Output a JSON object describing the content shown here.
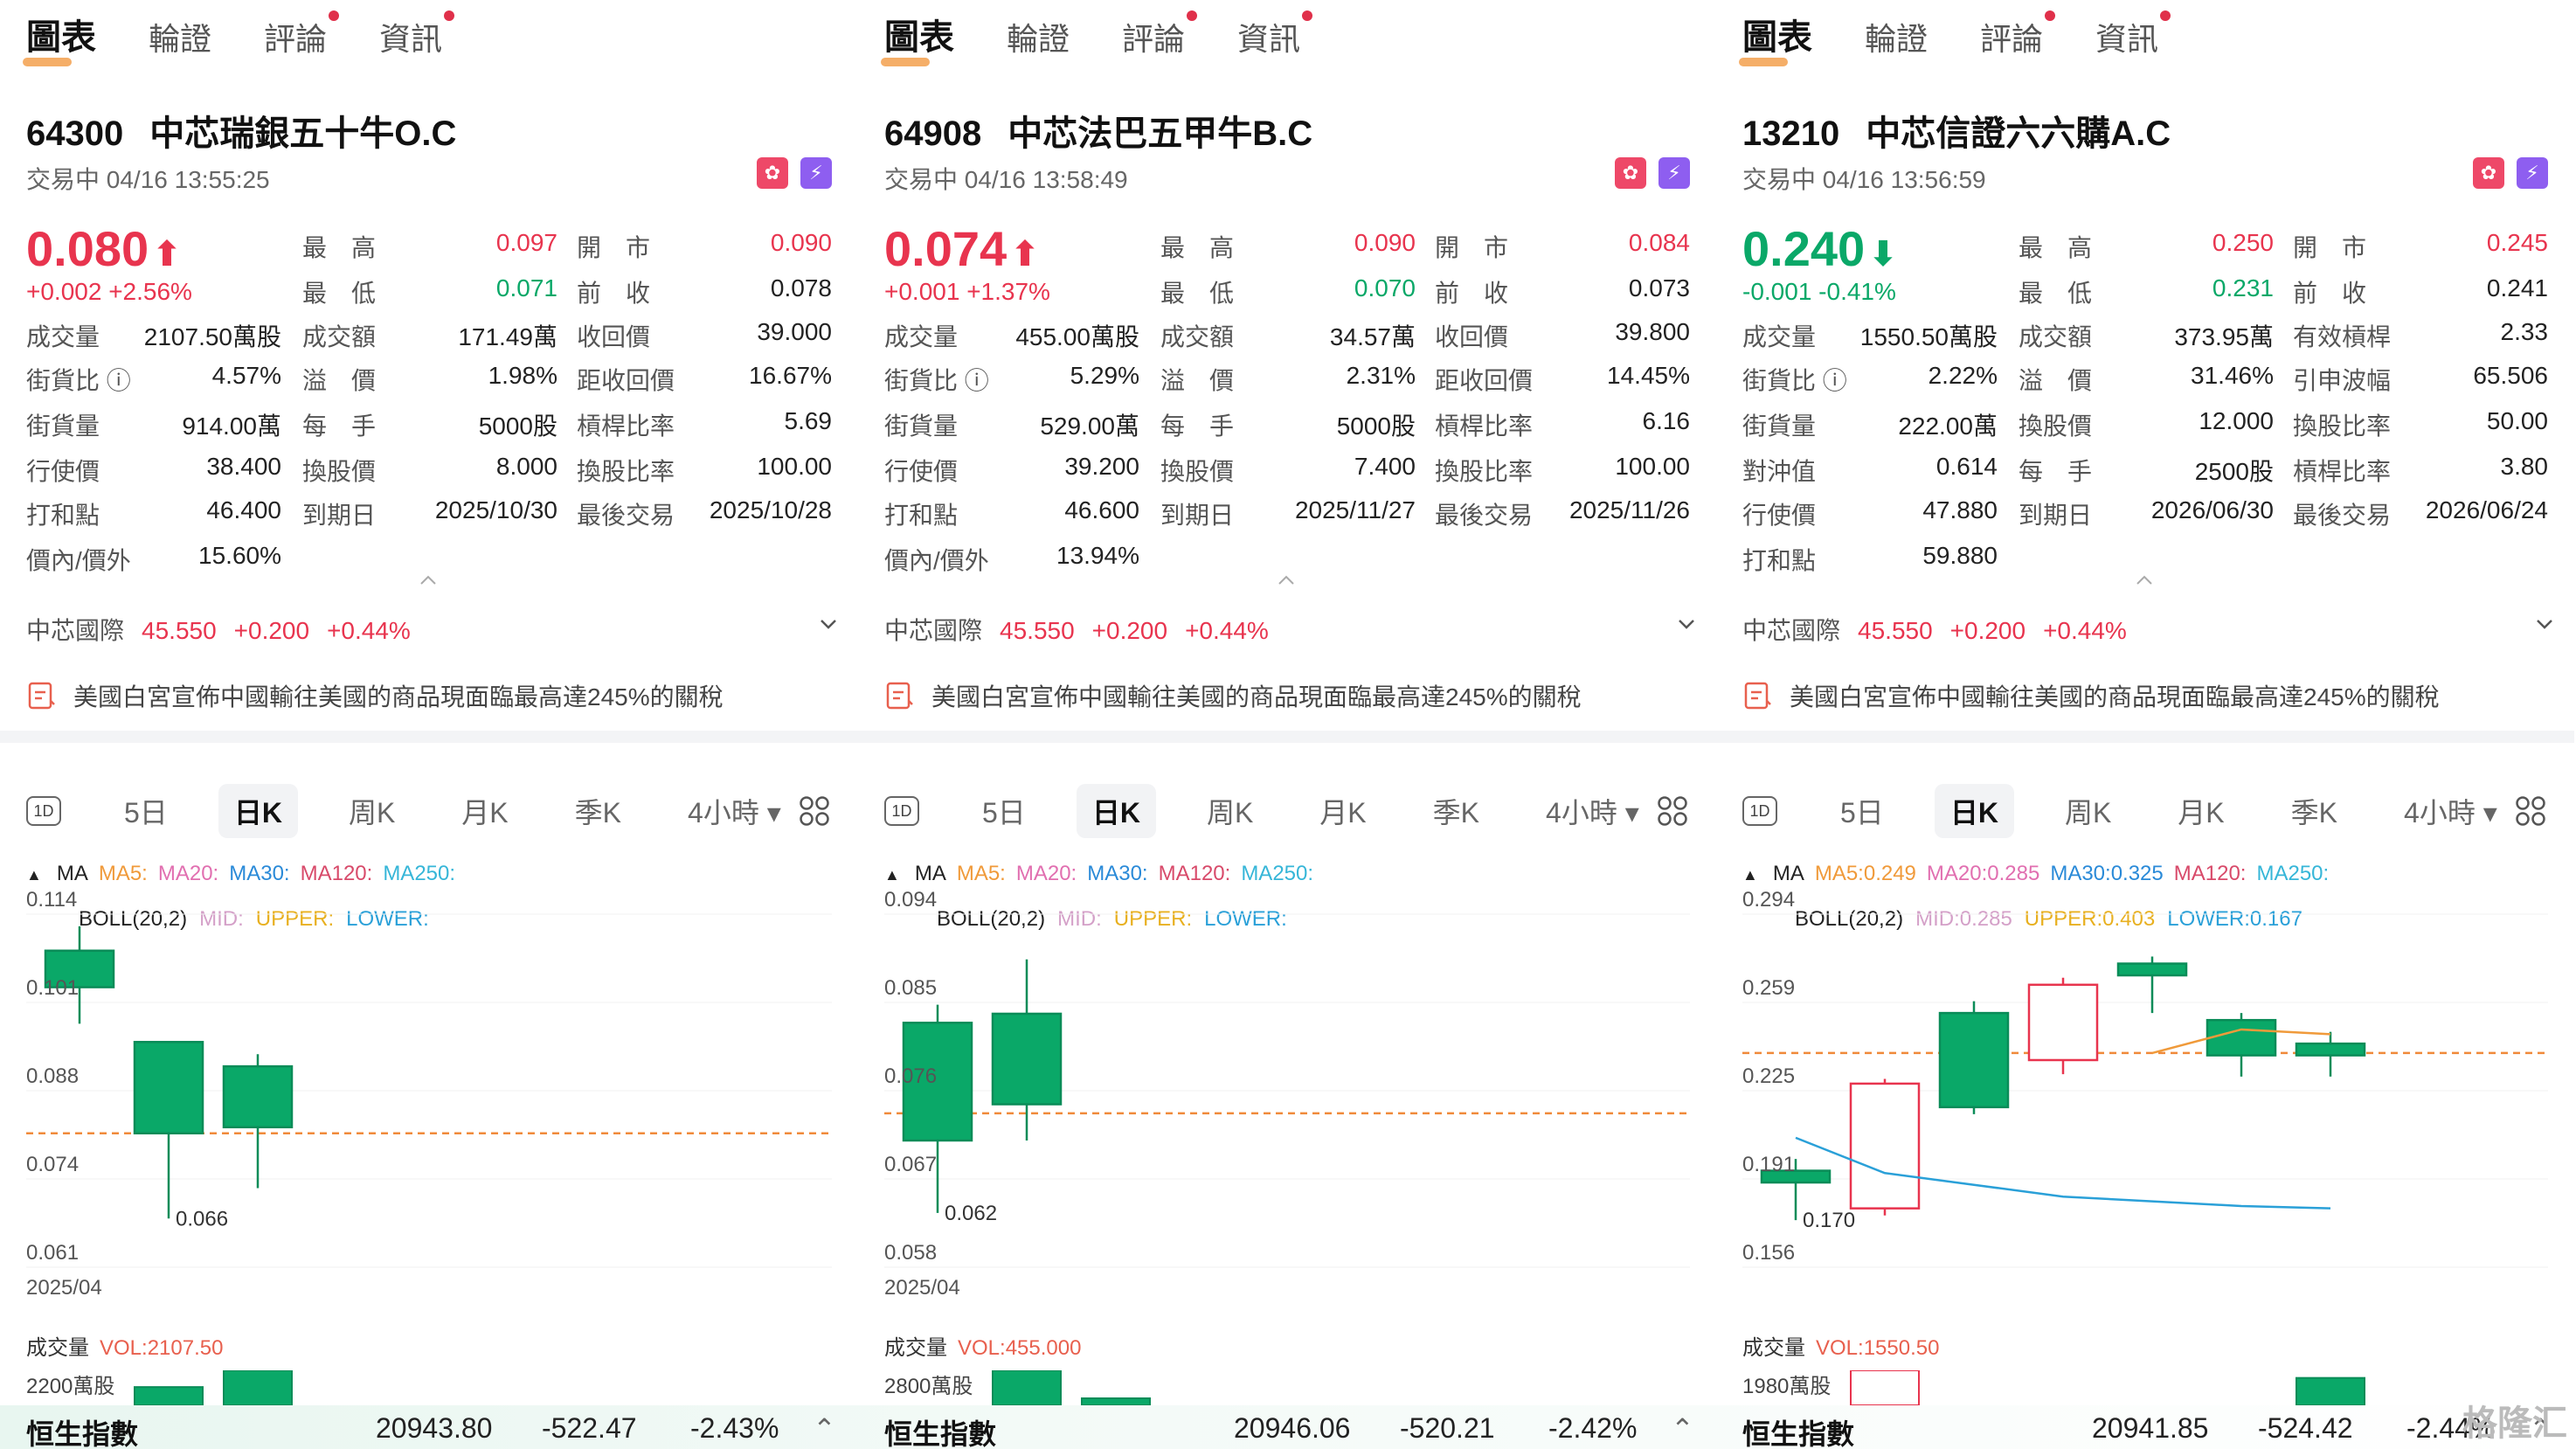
{
  "tabs": [
    "圖表",
    "輪證",
    "評論",
    "資訊"
  ],
  "panels": [
    {
      "code": "64300",
      "name": "中芯瑞銀五十牛O.C",
      "status": "交易中 04/16 13:55:25",
      "price": "0.080",
      "dir": "up",
      "change": "+0.002 +2.56%",
      "rows": [
        [
          [
            "最　高",
            "0.097",
            "red"
          ],
          [
            "開　市",
            "0.090",
            "red"
          ]
        ],
        [
          [
            "最　低",
            "0.071",
            "green"
          ],
          [
            "前　收",
            "0.078",
            ""
          ]
        ],
        [
          [
            "成交量",
            "2107.50萬股"
          ],
          [
            "成交額",
            "171.49萬"
          ],
          [
            "收回價",
            "39.000"
          ]
        ],
        [
          [
            "街貨比 ⓘ",
            "4.57%"
          ],
          [
            "溢　價",
            "1.98%"
          ],
          [
            "距收回價",
            "16.67%"
          ]
        ],
        [
          [
            "街貨量",
            "914.00萬"
          ],
          [
            "每　手",
            "5000股"
          ],
          [
            "槓桿比率",
            "5.69"
          ]
        ],
        [
          [
            "行使價",
            "38.400"
          ],
          [
            "換股價",
            "8.000"
          ],
          [
            "換股比率",
            "100.00"
          ]
        ],
        [
          [
            "打和點",
            "46.400"
          ],
          [
            "到期日",
            "2025/10/30"
          ],
          [
            "最後交易",
            "2025/10/28"
          ]
        ],
        [
          [
            "價內/價外",
            "15.60%"
          ]
        ]
      ],
      "underlying": {
        "name": "中芯國際",
        "price": "45.550",
        "chg": "+0.200",
        "pct": "+0.44%"
      },
      "news": "美國白宮宣佈中國輸往美國的商品現面臨最高達245%的關稅",
      "legend1": {
        "ma": "MA",
        "ma5": "MA5:",
        "ma20": "MA20:",
        "ma30": "MA30:",
        "ma120": "MA120:",
        "ma250": "MA250:"
      },
      "legend2": {
        "boll": "BOLL(20,2)",
        "mid": "MID:",
        "upper": "UPPER:",
        "lower": "LOWER:"
      },
      "yticks": [
        "0.114",
        "0.101",
        "0.088",
        "0.074",
        "0.061"
      ],
      "xlabel": "2025/04",
      "low_label": "0.066",
      "vol_title": "成交量",
      "vol_value": "VOL:2107.50",
      "vol_max": "2200萬股"
    },
    {
      "code": "64908",
      "name": "中芯法巴五甲牛B.C",
      "status": "交易中 04/16 13:58:49",
      "price": "0.074",
      "dir": "up",
      "change": "+0.001 +1.37%",
      "rows": [
        [
          [
            "最　高",
            "0.090",
            "red"
          ],
          [
            "開　市",
            "0.084",
            "red"
          ]
        ],
        [
          [
            "最　低",
            "0.070",
            "green"
          ],
          [
            "前　收",
            "0.073",
            ""
          ]
        ],
        [
          [
            "成交量",
            "455.00萬股"
          ],
          [
            "成交額",
            "34.57萬"
          ],
          [
            "收回價",
            "39.800"
          ]
        ],
        [
          [
            "街貨比 ⓘ",
            "5.29%"
          ],
          [
            "溢　價",
            "2.31%"
          ],
          [
            "距收回價",
            "14.45%"
          ]
        ],
        [
          [
            "街貨量",
            "529.00萬"
          ],
          [
            "每　手",
            "5000股"
          ],
          [
            "槓桿比率",
            "6.16"
          ]
        ],
        [
          [
            "行使價",
            "39.200"
          ],
          [
            "換股價",
            "7.400"
          ],
          [
            "換股比率",
            "100.00"
          ]
        ],
        [
          [
            "打和點",
            "46.600"
          ],
          [
            "到期日",
            "2025/11/27"
          ],
          [
            "最後交易",
            "2025/11/26"
          ]
        ],
        [
          [
            "價內/價外",
            "13.94%"
          ]
        ]
      ],
      "underlying": {
        "name": "中芯國際",
        "price": "45.550",
        "chg": "+0.200",
        "pct": "+0.44%"
      },
      "news": "美國白宮宣佈中國輸往美國的商品現面臨最高達245%的關稅",
      "legend1": {
        "ma": "MA",
        "ma5": "MA5:",
        "ma20": "MA20:",
        "ma30": "MA30:",
        "ma120": "MA120:",
        "ma250": "MA250:"
      },
      "legend2": {
        "boll": "BOLL(20,2)",
        "mid": "MID:",
        "upper": "UPPER:",
        "lower": "LOWER:"
      },
      "yticks": [
        "0.094",
        "0.085",
        "0.076",
        "0.067",
        "0.058"
      ],
      "xlabel": "2025/04",
      "low_label": "0.062",
      "vol_title": "成交量",
      "vol_value": "VOL:455.000",
      "vol_max": "2800萬股"
    },
    {
      "code": "13210",
      "name": "中芯信證六六購A.C",
      "status": "交易中 04/16 13:56:59",
      "price": "0.240",
      "dir": "down",
      "change": "-0.001 -0.41%",
      "rows": [
        [
          [
            "最　高",
            "0.250",
            "red"
          ],
          [
            "開　市",
            "0.245",
            "red"
          ]
        ],
        [
          [
            "最　低",
            "0.231",
            "green"
          ],
          [
            "前　收",
            "0.241",
            ""
          ]
        ],
        [
          [
            "成交量",
            "1550.50萬股"
          ],
          [
            "成交額",
            "373.95萬"
          ],
          [
            "有效槓桿",
            "2.33"
          ]
        ],
        [
          [
            "街貨比 ⓘ",
            "2.22%"
          ],
          [
            "溢　價",
            "31.46%"
          ],
          [
            "引申波幅",
            "65.506"
          ]
        ],
        [
          [
            "街貨量",
            "222.00萬"
          ],
          [
            "換股價",
            "12.000"
          ],
          [
            "換股比率",
            "50.00"
          ]
        ],
        [
          [
            "對沖值",
            "0.614"
          ],
          [
            "每　手",
            "2500股"
          ],
          [
            "槓桿比率",
            "3.80"
          ]
        ],
        [
          [
            "行使價",
            "47.880"
          ],
          [
            "到期日",
            "2026/06/30"
          ],
          [
            "最後交易",
            "2026/06/24"
          ]
        ],
        [
          [
            "打和點",
            "59.880"
          ]
        ]
      ],
      "underlying": {
        "name": "中芯國際",
        "price": "45.550",
        "chg": "+0.200",
        "pct": "+0.44%"
      },
      "news": "美國白宮宣佈中國輸往美國的商品現面臨最高達245%的關稅",
      "legend1": {
        "ma": "MA",
        "ma5": "MA5:0.249",
        "ma20": "MA20:0.285",
        "ma30": "MA30:0.325",
        "ma120": "MA120:",
        "ma250": "MA250:"
      },
      "legend2": {
        "boll": "BOLL(20,2)",
        "mid": "MID:0.285",
        "upper": "UPPER:0.403",
        "lower": "LOWER:0.167"
      },
      "yticks": [
        "0.294",
        "0.259",
        "0.225",
        "0.191",
        "0.156"
      ],
      "xlabel": "",
      "low_label": "0.170",
      "vol_title": "成交量",
      "vol_value": "VOL:1550.50",
      "vol_max": "1980萬股"
    }
  ],
  "periods": [
    "1D",
    "5日",
    "日K",
    "周K",
    "月K",
    "季K",
    "4小時 ▾"
  ],
  "active_period": "日K",
  "ticker": [
    {
      "name": "恒生指數",
      "value": "20943.80",
      "chg": "-522.47",
      "pct": "-2.43%"
    },
    {
      "name": "恒生指數",
      "value": "20946.06",
      "chg": "-520.21",
      "pct": "-2.42%"
    },
    {
      "name": "恒生指數",
      "value": "20941.85",
      "chg": "-524.42",
      "pct": "-2.44%"
    }
  ],
  "watermark": "格隆汇",
  "chart_data": [
    {
      "type": "candlestick",
      "ylim": [
        0.058,
        0.116
      ],
      "candles": [
        {
          "open": 0.11,
          "close": 0.104,
          "high": 0.114,
          "low": 0.098
        },
        {
          "open": 0.095,
          "close": 0.08,
          "high": 0.095,
          "low": 0.066
        },
        {
          "open": 0.091,
          "close": 0.081,
          "high": 0.093,
          "low": 0.071
        }
      ],
      "ref_line": 0.08,
      "volumes": [
        1100,
        2107.5
      ]
    },
    {
      "type": "candlestick",
      "ylim": [
        0.056,
        0.095
      ],
      "candles": [
        {
          "open": 0.083,
          "close": 0.07,
          "high": 0.085,
          "low": 0.062
        },
        {
          "open": 0.084,
          "close": 0.074,
          "high": 0.09,
          "low": 0.07
        }
      ],
      "ref_line": 0.073,
      "volumes": [
        2800,
        455
      ]
    },
    {
      "type": "candlestick",
      "ylim": [
        0.15,
        0.3
      ],
      "candles": [
        {
          "open": 0.191,
          "close": 0.186,
          "high": 0.196,
          "low": 0.17
        },
        {
          "open": 0.175,
          "close": 0.228,
          "high": 0.23,
          "low": 0.172
        },
        {
          "open": 0.258,
          "close": 0.218,
          "high": 0.263,
          "low": 0.215
        },
        {
          "open": 0.238,
          "close": 0.27,
          "high": 0.273,
          "low": 0.232
        },
        {
          "open": 0.279,
          "close": 0.274,
          "high": 0.282,
          "low": 0.258
        },
        {
          "open": 0.255,
          "close": 0.24,
          "high": 0.258,
          "low": 0.231
        },
        {
          "open": 0.245,
          "close": 0.24,
          "high": 0.25,
          "low": 0.231
        }
      ],
      "ref_line": 0.241,
      "ma5": [
        null,
        null,
        null,
        null,
        0.241,
        0.251,
        0.249
      ],
      "lower": [
        0.205,
        0.19,
        0.185,
        0.18,
        0.178,
        0.176,
        0.175
      ],
      "volumes": [
        1980,
        1550.5
      ]
    }
  ]
}
